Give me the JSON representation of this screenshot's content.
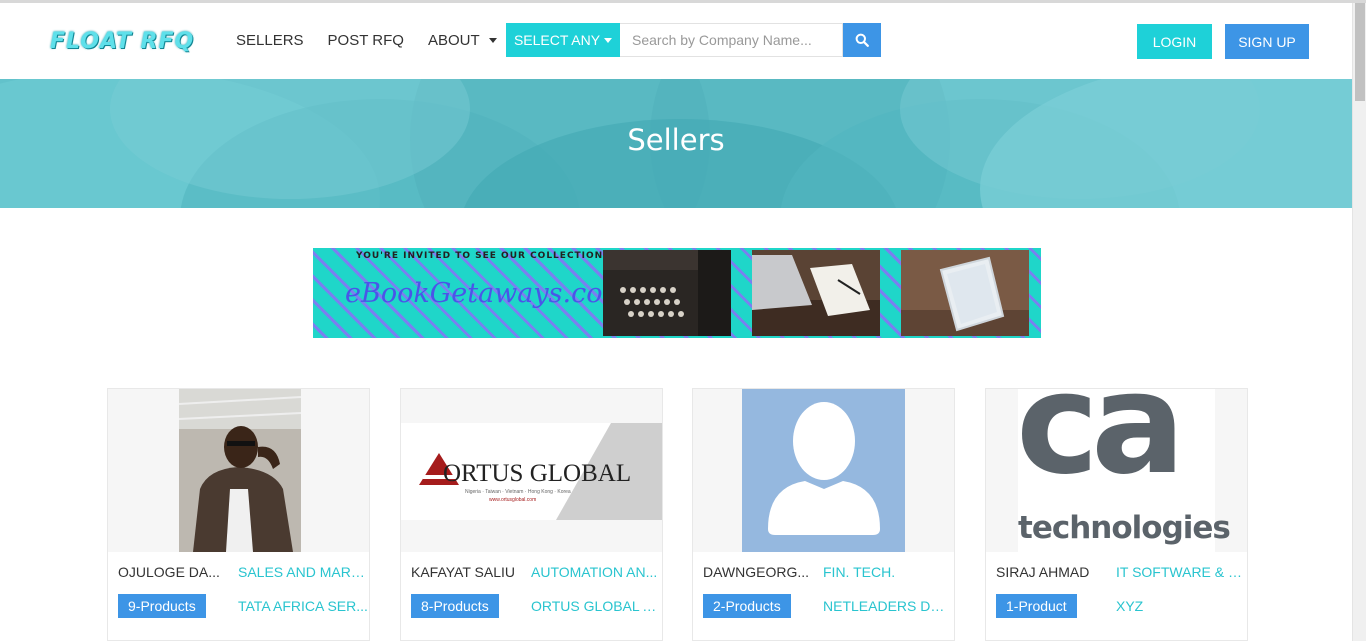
{
  "header": {
    "logo_text": "FLOAT RFQ",
    "nav": [
      {
        "label": "SELLERS"
      },
      {
        "label": "POST RFQ"
      },
      {
        "label": "ABOUT"
      }
    ],
    "select_label": "SELECT ANY",
    "search_placeholder": "Search by Company Name...",
    "login_label": "LOGIN",
    "signup_label": "SIGN UP"
  },
  "banner": {
    "title": "Sellers"
  },
  "ad": {
    "invite": "YOU'RE INVITED TO SEE OUR COLLECTIONS",
    "brand": "eBookGetaways.com"
  },
  "ortus_logo": {
    "name": "ORTUS GLOBAL",
    "tagline": "Nigeria · Taiwan · Vietnam · Hong Kong · Korea",
    "url": "www.ortusglobal.com"
  },
  "ca_logo": {
    "mark": "ca",
    "word": "technologies"
  },
  "sellers": [
    {
      "name": "OJULOGE DA...",
      "category": "SALES AND MARK...",
      "products": "9-Products",
      "company": "TATA AFRICA SER..."
    },
    {
      "name": "KAFAYAT SALIU",
      "category": "AUTOMATION AN...",
      "products": "8-Products",
      "company": "ORTUS GLOBAL A..."
    },
    {
      "name": "DAWNGEORG...",
      "category": "FIN. TECH.",
      "products": "2-Products",
      "company": "NETLEADERS DAS..."
    },
    {
      "name": "SIRAJ AHMAD",
      "category": "IT SOFTWARE & H...",
      "products": "1-Product",
      "company": "XYZ"
    }
  ],
  "colors": {
    "teal": "#1ed1d8",
    "blue": "#3d95e6",
    "banner": "#5bbcc6",
    "link": "#29c4cf"
  }
}
